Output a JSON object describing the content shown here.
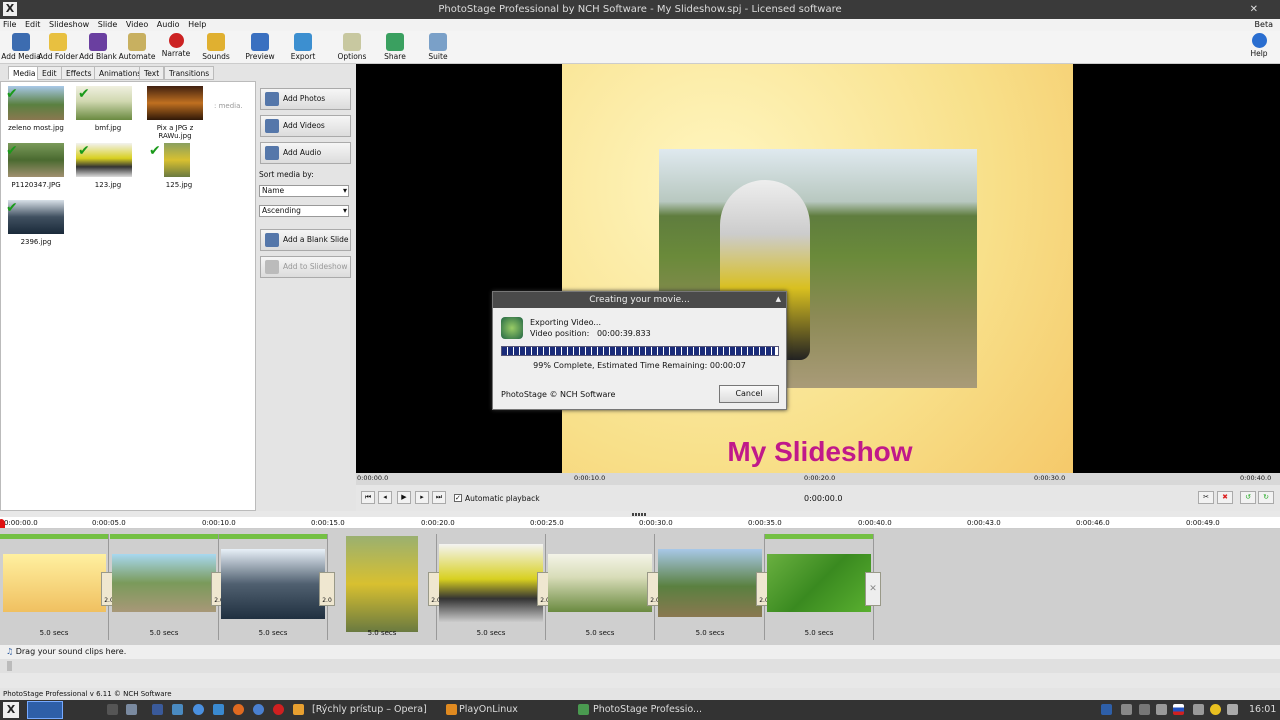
{
  "window": {
    "title": "PhotoStage Professional by NCH Software - My Slideshow.spj - Licensed software",
    "beta_label": "Beta"
  },
  "menu": [
    "File",
    "Edit",
    "Slideshow",
    "Slide",
    "Video",
    "Audio",
    "Help"
  ],
  "toolbar": [
    "Add Media",
    "Add Folder",
    "Add Blank",
    "Automate",
    "Narrate",
    "Sounds",
    "Preview",
    "Export",
    "Options",
    "Share",
    "Suite",
    "Help"
  ],
  "tabs": [
    "Media",
    "Edit",
    "Effects",
    "Animations",
    "Text",
    "Transitions"
  ],
  "media": {
    "items": [
      "zeleno most.jpg",
      "bmf.jpg",
      "Pix a JPG z RAWu.jpg",
      "P1120347.JPG",
      "123.jpg",
      "125.jpg",
      "2396.jpg"
    ],
    "hint": ": media."
  },
  "side": {
    "add_photos": "Add Photos",
    "add_videos": "Add Videos",
    "add_audio": "Add Audio",
    "sort_label": "Sort media by:",
    "sort_by": "Name",
    "sort_order": "Ascending",
    "add_blank_slide": "Add a Blank Slide",
    "add_to_slideshow": "Add to Slideshow"
  },
  "preview": {
    "slide_title": "My Slideshow",
    "ruler": [
      "0:00:00.0",
      "0:00:10.0",
      "0:00:20.0",
      "0:00:30.0",
      "0:00:40.0"
    ],
    "automatic_playback": "Automatic playback",
    "time": "0:00:00.0"
  },
  "dialog": {
    "title": "Creating your movie...",
    "line1": "Exporting Video...",
    "line2": "Video position:   00:00:39.833",
    "progress": 0.99,
    "status": "99% Complete, Estimated Time Remaining: 00:00:07",
    "copyright": "PhotoStage © NCH Software",
    "cancel": "Cancel"
  },
  "timeline": {
    "ruler": [
      "0:00:00.0",
      "0:00:05.0",
      "0:00:10.0",
      "0:00:15.0",
      "0:00:20.0",
      "0:00:25.0",
      "0:00:30.0",
      "0:00:35.0",
      "0:00:40.0",
      "0:00:43.0",
      "0:00:46.0",
      "0:00:49.0"
    ],
    "clip_duration": "5.0 secs",
    "transition_duration": "2.0",
    "sound_hint": "Drag your sound clips here."
  },
  "status": "PhotoStage Professional v 6.11 © NCH Software",
  "taskbar": {
    "opera": "[Rýchly prístup – Opera]",
    "playonlinux": "PlayOnLinux",
    "photostage": "PhotoStage Professio...",
    "clock": "16:01"
  }
}
